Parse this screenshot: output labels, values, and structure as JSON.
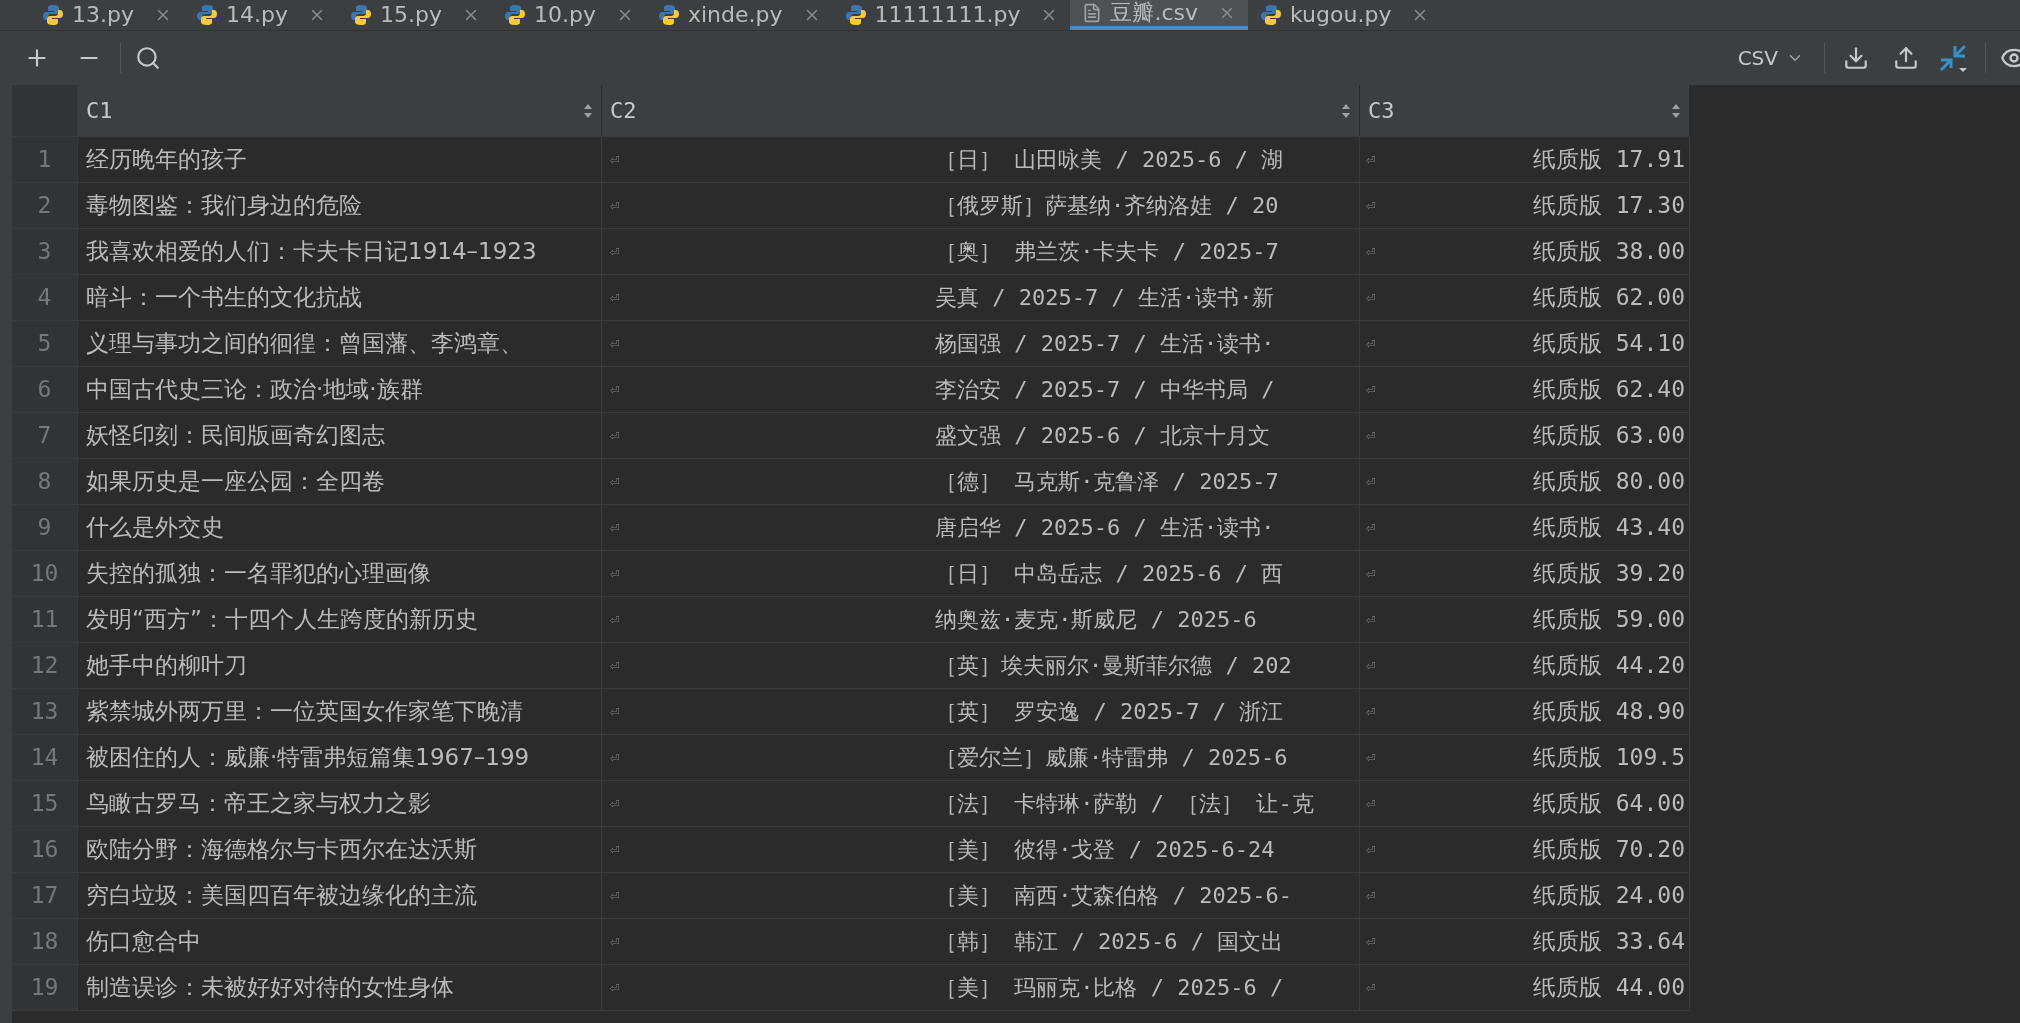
{
  "tabs": [
    {
      "label": "13.py",
      "kind": "python",
      "selected": false
    },
    {
      "label": "14.py",
      "kind": "python",
      "selected": false
    },
    {
      "label": "15.py",
      "kind": "python",
      "selected": false
    },
    {
      "label": "10.py",
      "kind": "python",
      "selected": false
    },
    {
      "label": "xinde.py",
      "kind": "python",
      "selected": false
    },
    {
      "label": "11111111.py",
      "kind": "python",
      "selected": false
    },
    {
      "label": "豆瓣.csv",
      "kind": "text",
      "selected": true
    },
    {
      "label": "kugou.py",
      "kind": "python",
      "selected": false
    }
  ],
  "toolbar": {
    "format": "CSV"
  },
  "table": {
    "columns": [
      "C1",
      "C2",
      "C3"
    ],
    "rows": [
      {
        "num": "1",
        "c1": "经历晚年的孩子",
        "c2_mark": "⏎",
        "c2": "［日］ 山田咏美 / 2025-6 / 湖",
        "c3_mark": "⏎",
        "c3": "纸质版 17.91"
      },
      {
        "num": "2",
        "c1": "毒物图鉴：我们身边的危险",
        "c2_mark": "⏎",
        "c2": "［俄罗斯］萨基纳·齐纳洛娃 / 20",
        "c3_mark": "⏎",
        "c3": "纸质版 17.30"
      },
      {
        "num": "3",
        "c1": "我喜欢相爱的人们：卡夫卡日记1914–1923",
        "c2_mark": "⏎",
        "c2": "［奥］ 弗兰茨·卡夫卡 / 2025-7",
        "c3_mark": "⏎",
        "c3": "纸质版 38.00"
      },
      {
        "num": "4",
        "c1": "暗斗：一个书生的文化抗战",
        "c2_mark": "⏎",
        "c2": "吴真 / 2025-7 / 生活·读书·新",
        "c3_mark": "⏎",
        "c3": "纸质版 62.00"
      },
      {
        "num": "5",
        "c1": "义理与事功之间的徊徨：曾国藩、李鸿章、",
        "c2_mark": "⏎",
        "c2": "杨国强 / 2025-7 / 生活·读书·",
        "c3_mark": "⏎",
        "c3": "纸质版 54.10"
      },
      {
        "num": "6",
        "c1": "中国古代史三论：政治·地域·族群",
        "c2_mark": "⏎",
        "c2": "李治安 / 2025-7 / 中华书局 /",
        "c3_mark": "⏎",
        "c3": "纸质版 62.40"
      },
      {
        "num": "7",
        "c1": "妖怪印刻：民间版画奇幻图志",
        "c2_mark": "⏎",
        "c2": "盛文强 / 2025-6 / 北京十月文",
        "c3_mark": "⏎",
        "c3": "纸质版 63.00"
      },
      {
        "num": "8",
        "c1": "如果历史是一座公园：全四卷",
        "c2_mark": "⏎",
        "c2": "［德］ 马克斯·克鲁泽 / 2025-7",
        "c3_mark": "⏎",
        "c3": "纸质版 80.00"
      },
      {
        "num": "9",
        "c1": "什么是外交史",
        "c2_mark": "⏎",
        "c2": "唐启华 / 2025-6 / 生活·读书·",
        "c3_mark": "⏎",
        "c3": "纸质版 43.40"
      },
      {
        "num": "10",
        "c1": "失控的孤独：一名罪犯的心理画像",
        "c2_mark": "⏎",
        "c2": "［日］ 中岛岳志 / 2025-6 / 西",
        "c3_mark": "⏎",
        "c3": "纸质版 39.20"
      },
      {
        "num": "11",
        "c1": "发明“西方”：十四个人生跨度的新历史",
        "c2_mark": "⏎",
        "c2": "纳奥兹·麦克·斯威尼 / 2025-6",
        "c3_mark": "⏎",
        "c3": "纸质版 59.00"
      },
      {
        "num": "12",
        "c1": "她手中的柳叶刀",
        "c2_mark": "⏎",
        "c2": "［英］埃夫丽尔·曼斯菲尔德 / 202",
        "c3_mark": "⏎",
        "c3": "纸质版 44.20"
      },
      {
        "num": "13",
        "c1": "紫禁城外两万里：一位英国女作家笔下晚清",
        "c2_mark": "⏎",
        "c2": "［英］ 罗安逸 / 2025-7 / 浙江",
        "c3_mark": "⏎",
        "c3": "纸质版 48.90"
      },
      {
        "num": "14",
        "c1": "被困住的人：威廉·特雷弗短篇集1967–199",
        "c2_mark": "⏎",
        "c2": "［爱尔兰］威廉·特雷弗 / 2025-6",
        "c3_mark": "⏎",
        "c3": "纸质版 109.5"
      },
      {
        "num": "15",
        "c1": "鸟瞰古罗马：帝王之家与权力之影",
        "c2_mark": "⏎",
        "c2": "［法］ 卡特琳·萨勒 / ［法］ 让-克",
        "c3_mark": "⏎",
        "c3": "纸质版 64.00"
      },
      {
        "num": "16",
        "c1": "欧陆分野：海德格尔与卡西尔在达沃斯",
        "c2_mark": "⏎",
        "c2": "［美］ 彼得·戈登 / 2025-6-24",
        "c3_mark": "⏎",
        "c3": "纸质版 70.20"
      },
      {
        "num": "17",
        "c1": "穷白垃圾：美国四百年被边缘化的主流",
        "c2_mark": "⏎",
        "c2": "［美］ 南西·艾森伯格 / 2025-6-",
        "c3_mark": "⏎",
        "c3": "纸质版 24.00"
      },
      {
        "num": "18",
        "c1": "伤口愈合中",
        "c2_mark": "⏎",
        "c2": "［韩］ 韩江 / 2025-6 / 国文出",
        "c3_mark": "⏎",
        "c3": "纸质版 33.64"
      },
      {
        "num": "19",
        "c1": "制造误诊：未被好好对待的女性身体",
        "c2_mark": "⏎",
        "c2": "［美］ 玛丽克·比格 / 2025-6 /",
        "c3_mark": "⏎",
        "c3": "纸质版 44.00"
      }
    ]
  }
}
